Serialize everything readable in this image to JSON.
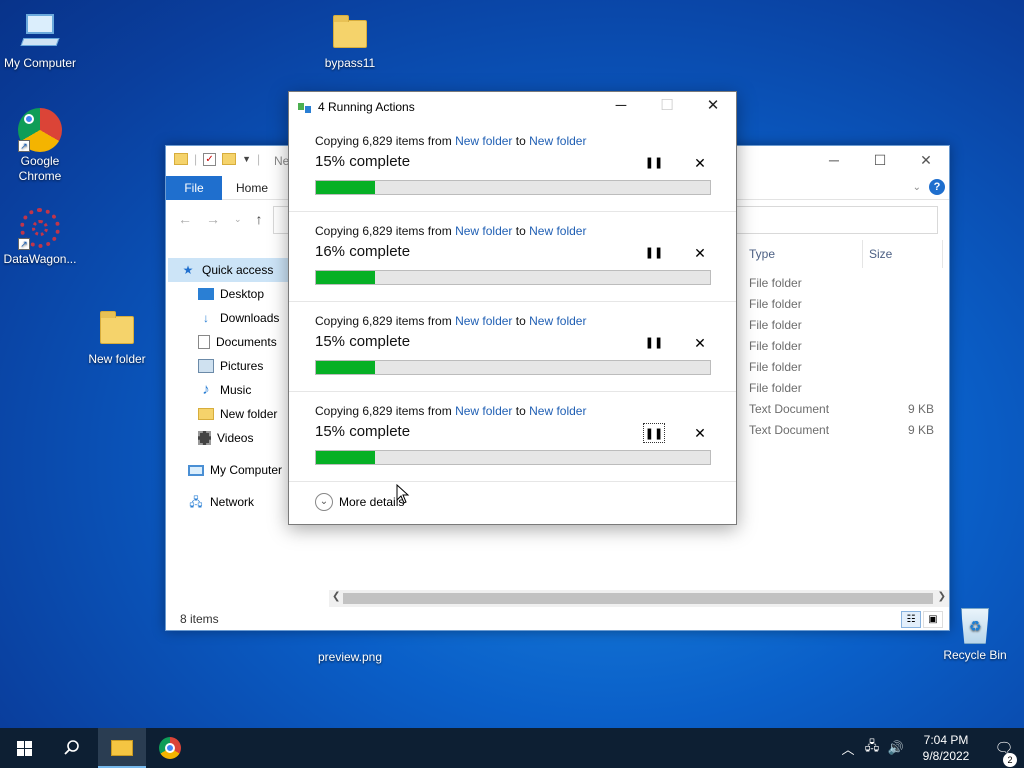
{
  "desktop": {
    "icons": {
      "my_computer": "My Computer",
      "bypass11": "bypass11",
      "google_chrome": "Google Chrome",
      "datawagon": "DataWagon...",
      "new_folder": "New folder",
      "preview_png": "preview.png",
      "recycle_bin": "Recycle Bin"
    }
  },
  "explorer": {
    "title_partial": "Ne",
    "ribbon": {
      "file": "File",
      "home": "Home"
    },
    "nav": {
      "quick_access": "Quick access",
      "desktop": "Desktop",
      "downloads": "Downloads",
      "documents": "Documents",
      "pictures": "Pictures",
      "music": "Music",
      "new_folder": "New folder",
      "videos": "Videos",
      "my_computer": "My Computer",
      "network": "Network"
    },
    "columns": {
      "type": "Type",
      "size": "Size"
    },
    "rows": [
      {
        "type": "File folder",
        "size": ""
      },
      {
        "type": "File folder",
        "size": ""
      },
      {
        "type": "File folder",
        "size": ""
      },
      {
        "type": "File folder",
        "size": ""
      },
      {
        "type": "File folder",
        "size": ""
      },
      {
        "type": "File folder",
        "size": ""
      },
      {
        "type": "Text Document",
        "size": "9 KB"
      },
      {
        "type": "Text Document",
        "size": "9 KB"
      }
    ],
    "status": "8 items"
  },
  "dialog": {
    "title": "4 Running Actions",
    "actions": [
      {
        "prefix": "Copying 6,829 items from ",
        "from": "New folder",
        "mid": " to ",
        "to": "New folder",
        "percent_label": "15% complete",
        "progress": 15
      },
      {
        "prefix": "Copying 6,829 items from ",
        "from": "New folder",
        "mid": " to ",
        "to": "New folder",
        "percent_label": "16% complete",
        "progress": 15
      },
      {
        "prefix": "Copying 6,829 items from ",
        "from": "New folder",
        "mid": " to ",
        "to": "New folder",
        "percent_label": "15% complete",
        "progress": 15
      },
      {
        "prefix": "Copying 6,829 items from ",
        "from": "New folder",
        "mid": " to ",
        "to": "New folder",
        "percent_label": "15% complete",
        "progress": 15
      }
    ],
    "more_details": "More details",
    "progress_color": "#06b025"
  },
  "taskbar": {
    "time": "7:04 PM",
    "date": "9/8/2022",
    "notification_count": "2"
  }
}
